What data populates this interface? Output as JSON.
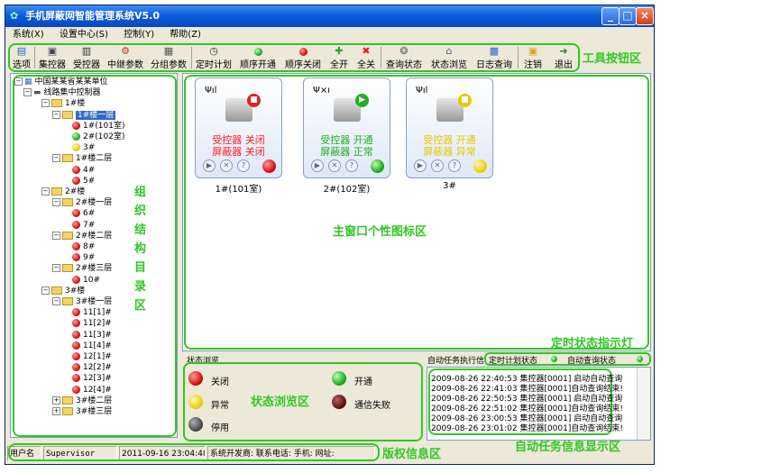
{
  "window": {
    "title": "手机屏蔽网智能管理系统V5.0"
  },
  "menu": [
    "系统(X)",
    "设置中心(S)",
    "控制(Y)",
    "帮助(Z)"
  ],
  "toolbar": [
    {
      "label": "选项",
      "icon": "options-icon"
    },
    {
      "label": "集控器",
      "icon": "concentrator-icon"
    },
    {
      "label": "受控器",
      "icon": "controlled-device-icon"
    },
    {
      "label": "中继参数",
      "icon": "relay-params-icon"
    },
    {
      "label": "分组参数",
      "icon": "group-params-icon"
    },
    {
      "label": "定时计划",
      "icon": "clock-icon"
    },
    {
      "label": "顺序开通",
      "icon": "green-ball-icon"
    },
    {
      "label": "顺序关闭",
      "icon": "red-ball-icon"
    },
    {
      "label": "全开",
      "icon": "all-on-icon"
    },
    {
      "label": "全关",
      "icon": "all-off-icon"
    },
    {
      "label": "查询状态",
      "icon": "query-status-icon"
    },
    {
      "label": "状态浏览",
      "icon": "status-browse-icon"
    },
    {
      "label": "日志查询",
      "icon": "log-query-icon"
    },
    {
      "label": "注销",
      "icon": "logout-icon"
    },
    {
      "label": "退出",
      "icon": "exit-icon"
    }
  ],
  "annotations": {
    "toolbar": "工具按钮区",
    "tree": [
      "组",
      "织",
      "结",
      "构",
      "目",
      "录",
      "区"
    ],
    "icons": "主窗口个性图标区",
    "timer_light": "定时状态指示灯",
    "status_browse": "状态浏览区",
    "task_info": "自动任务信息显示区",
    "copyright": "版权信息区"
  },
  "tree": {
    "root": "中国某某省某某单位",
    "controller": "线路集中控制器",
    "nodes": [
      {
        "label": "1#楼",
        "level": 2,
        "type": "folder"
      },
      {
        "label": "1#楼一层",
        "level": 3,
        "type": "folder",
        "selected": true
      },
      {
        "label": "1#(101室)",
        "level": 4,
        "status": "red"
      },
      {
        "label": "2#(102室)",
        "level": 4,
        "status": "green"
      },
      {
        "label": "3#",
        "level": 4,
        "status": "yellow"
      },
      {
        "label": "1#楼二层",
        "level": 3,
        "type": "folder"
      },
      {
        "label": "4#",
        "level": 4,
        "status": "red"
      },
      {
        "label": "5#",
        "level": 4,
        "status": "red"
      },
      {
        "label": "2#楼",
        "level": 2,
        "type": "folder"
      },
      {
        "label": "2#楼一层",
        "level": 3,
        "type": "folder"
      },
      {
        "label": "6#",
        "level": 4,
        "status": "red"
      },
      {
        "label": "7#",
        "level": 4,
        "status": "red"
      },
      {
        "label": "2#楼二层",
        "level": 3,
        "type": "folder"
      },
      {
        "label": "8#",
        "level": 4,
        "status": "red"
      },
      {
        "label": "9#",
        "level": 4,
        "status": "red"
      },
      {
        "label": "2#楼三层",
        "level": 3,
        "type": "folder"
      },
      {
        "label": "10#",
        "level": 4,
        "status": "red"
      },
      {
        "label": "3#楼",
        "level": 2,
        "type": "folder"
      },
      {
        "label": "3#楼一层",
        "level": 3,
        "type": "folder"
      },
      {
        "label": "11[1]#",
        "level": 4,
        "status": "red"
      },
      {
        "label": "11[2]#",
        "level": 4,
        "status": "red"
      },
      {
        "label": "11[3]#",
        "level": 4,
        "status": "red"
      },
      {
        "label": "11[4]#",
        "level": 4,
        "status": "red"
      },
      {
        "label": "12[1]#",
        "level": 4,
        "status": "red"
      },
      {
        "label": "12[2]#",
        "level": 4,
        "status": "red"
      },
      {
        "label": "12[3]#",
        "level": 4,
        "status": "red"
      },
      {
        "label": "12[4]#",
        "level": 4,
        "status": "red"
      },
      {
        "label": "3#楼二层",
        "level": 3,
        "type": "folder"
      },
      {
        "label": "3#楼三层",
        "level": 3,
        "type": "folder"
      }
    ]
  },
  "devices": [
    {
      "caption": "1#(101室)",
      "line1": "受控器 关闭",
      "line2": "屏蔽器 关闭",
      "color": "#ff2020",
      "badge_color": "#e02020",
      "status_color": "red"
    },
    {
      "caption": "2#(102室)",
      "line1": "受控器 开通",
      "line2": "屏蔽器 正常",
      "color": "#20b020",
      "badge_color": "#20b020",
      "status_color": "green"
    },
    {
      "caption": "3#",
      "line1": "受控器 开通",
      "line2": "屏蔽器 异常",
      "color": "#e8c800",
      "badge_color": "#e8c800",
      "status_color": "yellow"
    }
  ],
  "status_legend": {
    "title": "状态浏览",
    "items": [
      {
        "label": "关闭",
        "color": "red"
      },
      {
        "label": "开通",
        "color": "green"
      },
      {
        "label": "异常",
        "color": "yellow"
      },
      {
        "label": "通信失败",
        "color": "darkred"
      },
      {
        "label": "停用",
        "color": "gray"
      }
    ]
  },
  "auto_task": {
    "title": "自动任务执行信",
    "timer_label": "定时计划状态",
    "query_label": "自动查询状态",
    "logs": [
      "2009-08-26 22:40:53 集控器[0001] 启动自动查询",
      "2009-08-26 22:41:03 集控器[0001]自动查询结束!",
      "2009-08-26 22:50:53 集控器[0001] 启动自动查询",
      "2009-08-26 22:51:02 集控器[0001]自动查询结束!",
      "2009-08-26 23:00:53 集控器[0001] 启动自动查询",
      "2009-08-26 23:01:02 集控器[0001]自动查询结束!"
    ]
  },
  "statusbar": {
    "user_label": "用户名",
    "user": "Supervisor",
    "datetime": "2011-09-16 23:04:48",
    "info": "系统开发商: 联系电话: 手机: 网址:"
  }
}
